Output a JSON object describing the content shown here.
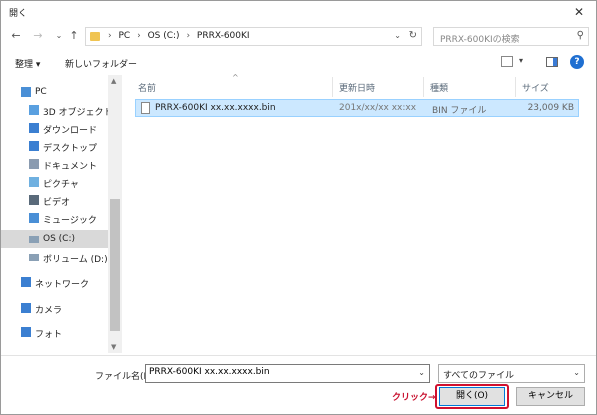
{
  "window": {
    "title": "開く"
  },
  "address": {
    "breadcrumbs": [
      "PC",
      "OS (C:)",
      "PRRX-600KI"
    ]
  },
  "search": {
    "placeholder": "PRRX-600KIの検索"
  },
  "toolbar": {
    "organize": "整理",
    "organize_arrow": "▾",
    "new_folder": "新しいフォルダー"
  },
  "nav": {
    "items": [
      {
        "label": "PC",
        "icon": "pc-icon",
        "color": "#4a8fd6"
      },
      {
        "label": "3D オブジェクト",
        "icon": "3d-objects-icon",
        "color": "#5aa0e0"
      },
      {
        "label": "ダウンロード",
        "icon": "download-icon",
        "color": "#3b7fd1"
      },
      {
        "label": "デスクトップ",
        "icon": "desktop-icon",
        "color": "#3b7fd1"
      },
      {
        "label": "ドキュメント",
        "icon": "documents-icon",
        "color": "#8a9bb0"
      },
      {
        "label": "ピクチャ",
        "icon": "pictures-icon",
        "color": "#6fb0e0"
      },
      {
        "label": "ビデオ",
        "icon": "videos-icon",
        "color": "#5a6a7a"
      },
      {
        "label": "ミュージック",
        "icon": "music-icon",
        "color": "#4a8fd6"
      },
      {
        "label": "OS (C:)",
        "icon": "drive-icon",
        "color": "#8aa0b5"
      },
      {
        "label": "ボリューム (D:)",
        "icon": "drive-icon",
        "color": "#8aa0b5"
      },
      {
        "label": "ネットワーク",
        "icon": "network-icon",
        "color": "#3b7fd1"
      },
      {
        "label": "カメラ",
        "icon": "camera-icon",
        "color": "#3b7fd1"
      },
      {
        "label": "フォト",
        "icon": "photos-icon",
        "color": "#3b7fd1"
      }
    ]
  },
  "columns": {
    "name": "名前",
    "modified": "更新日時",
    "type": "種類",
    "size": "サイズ"
  },
  "files": [
    {
      "name": "PRRX-600KI xx.xx.xxxx.bin",
      "modified": "201x/xx/xx xx:xx",
      "type": "BIN ファイル",
      "size": "23,009 KB"
    }
  ],
  "bottom": {
    "filename_label": "ファイル名(N):",
    "filename_value": "PRRX-600KI xx.xx.xxxx.bin",
    "filetype": "すべてのファイル",
    "open_button": "開く(O)",
    "cancel_button": "キャンセル",
    "annotation": "クリック→"
  },
  "colors": {
    "selection": "#cce8ff",
    "annotation": "#c8102e",
    "accent": "#0078d7"
  }
}
